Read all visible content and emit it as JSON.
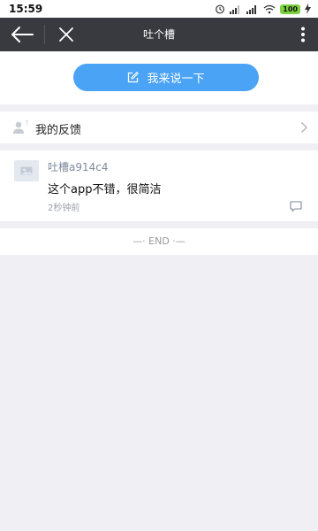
{
  "status_bar": {
    "time": "15:59",
    "battery": "100"
  },
  "nav": {
    "title": "吐个槽"
  },
  "actions": {
    "speak_button": "我来说一下"
  },
  "feedback": {
    "label": "我的反馈"
  },
  "comments": [
    {
      "user": "吐槽a914c4",
      "text": "这个app不错，很简洁",
      "time": "2秒钟前"
    }
  ],
  "footer": {
    "end": "—·  END  ·—"
  },
  "colors": {
    "nav_bg": "#393a3f",
    "accent": "#4aa3f5",
    "page_bg": "#efeff4"
  }
}
